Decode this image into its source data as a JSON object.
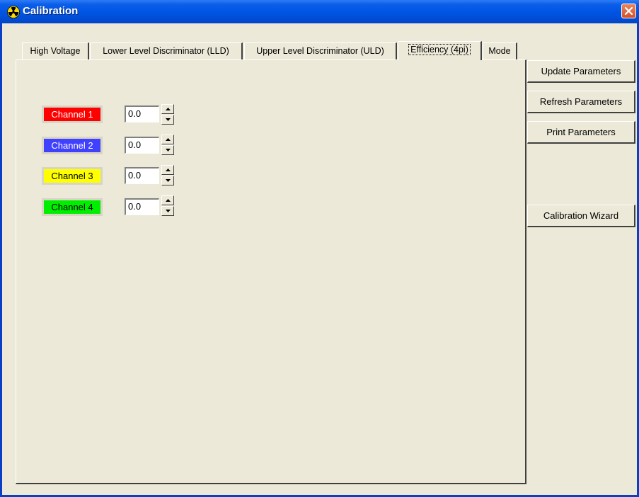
{
  "window": {
    "title": "Calibration"
  },
  "tabs": [
    {
      "label": "High Voltage"
    },
    {
      "label": "Lower Level Discriminator (LLD)"
    },
    {
      "label": "Upper Level Discriminator (ULD)"
    },
    {
      "label": "Efficiency (4pi)"
    },
    {
      "label": "Mode"
    }
  ],
  "active_tab": "Efficiency (4pi)",
  "side_buttons": {
    "update": "Update Parameters",
    "refresh": "Refresh Parameters",
    "print": "Print Parameters",
    "wizard": "Calibration Wizard"
  },
  "channels": [
    {
      "label": "Channel 1",
      "value": "0.0",
      "color": "#ff0000"
    },
    {
      "label": "Channel 2",
      "value": "0.0",
      "color": "#4040ff"
    },
    {
      "label": "Channel 3",
      "value": "0.0",
      "color": "#ffff00"
    },
    {
      "label": "Channel 4",
      "value": "0.0",
      "color": "#00ee00"
    }
  ],
  "icons": {
    "app": "radiation-icon",
    "close": "close-icon",
    "spin_up": "up-arrow-icon",
    "spin_down": "down-arrow-icon"
  }
}
